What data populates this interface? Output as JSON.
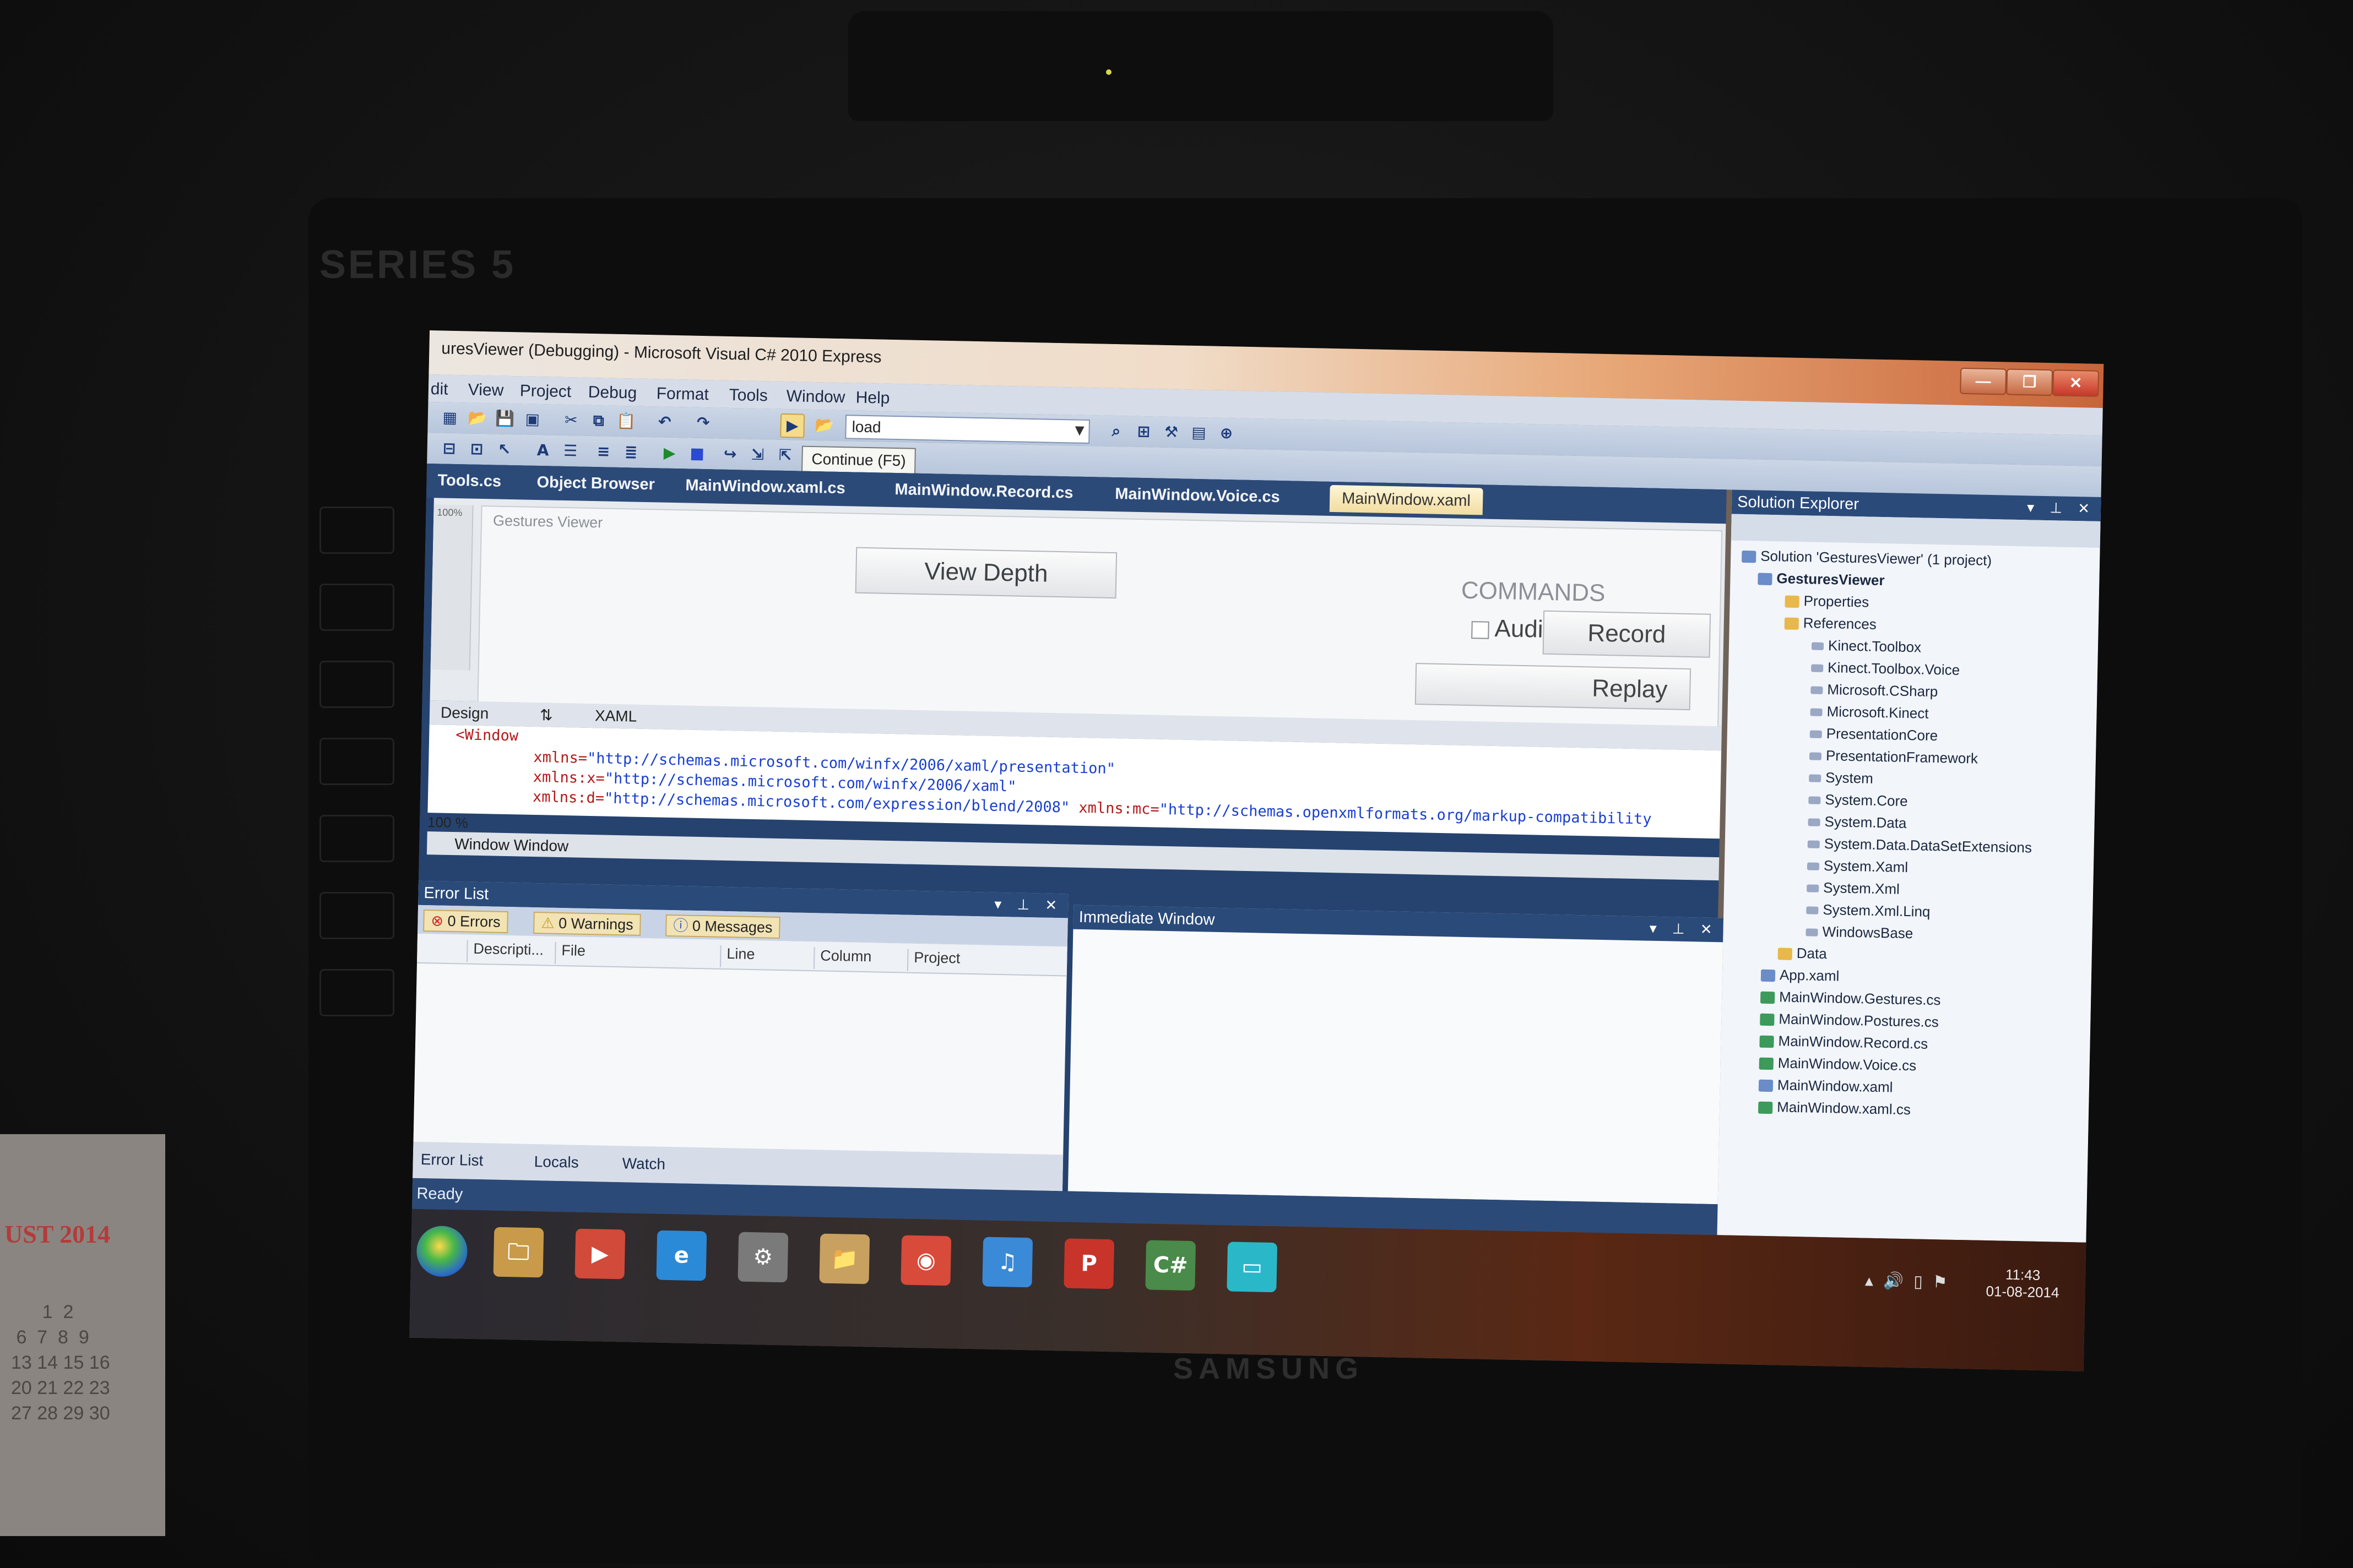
{
  "window": {
    "title": "uresViewer (Debugging) - Microsoft Visual C# 2010 Express",
    "minimize": "—",
    "restore": "❐",
    "close": "✕"
  },
  "menu": [
    "dit",
    "View",
    "Project",
    "Debug",
    "Format",
    "Tools",
    "Window",
    "Help"
  ],
  "toolbar": {
    "config_value": "load",
    "tooltip": "Continue (F5)"
  },
  "doc_tabs": [
    {
      "label": "Tools.cs"
    },
    {
      "label": "Object Browser"
    },
    {
      "label": "MainWindow.xaml.cs"
    },
    {
      "label": "MainWindow.Record.cs"
    },
    {
      "label": "MainWindow.Voice.cs"
    },
    {
      "label": "MainWindow.xaml",
      "active": true
    }
  ],
  "designer": {
    "zoom_label": "100%",
    "frame_title": "Gestures Viewer",
    "view_depth": "View Depth",
    "commands": "COMMANDS",
    "audio": "Audio",
    "record": "Record",
    "replay": "Replay"
  },
  "split_tabs": {
    "design": "Design",
    "swap": "⇅",
    "xaml": "XAML"
  },
  "code": {
    "root": "<Window",
    "lines": [
      {
        "attr": "xmlns=",
        "value": "\"http://schemas.microsoft.com/winfx/2006/xaml/presentation\""
      },
      {
        "attr": "xmlns:x=",
        "value": "\"http://schemas.microsoft.com/winfx/2006/xaml\""
      },
      {
        "attr": "xmlns:d=",
        "value": "\"http://schemas.microsoft.com/expression/blend/2008\"",
        "extra_attr": " xmlns:mc=",
        "extra_value": "\"http://schemas.openxmlformats.org/markup-compatibility"
      }
    ],
    "zoom": "100 %",
    "path": "Window  Window"
  },
  "error_list": {
    "title": "Error List",
    "errors": "0 Errors",
    "warnings": "0 Warnings",
    "messages": "0 Messages",
    "columns": [
      "Descripti...",
      "File",
      "Line",
      "Column",
      "Project"
    ],
    "bottom_tabs": [
      "Error List",
      "Locals",
      "Watch"
    ]
  },
  "immediate": {
    "title": "Immediate Window"
  },
  "status": "Ready",
  "solution_explorer": {
    "title": "Solution Explorer",
    "items": [
      {
        "label": "Solution 'GesturesViewer' (1 project)",
        "kind": "solution"
      },
      {
        "label": "GesturesViewer",
        "kind": "project"
      },
      {
        "label": "Properties",
        "kind": "folder"
      },
      {
        "label": "References",
        "kind": "folder"
      },
      {
        "label": "Kinect.Toolbox",
        "kind": "ref"
      },
      {
        "label": "Kinect.Toolbox.Voice",
        "kind": "ref"
      },
      {
        "label": "Microsoft.CSharp",
        "kind": "ref"
      },
      {
        "label": "Microsoft.Kinect",
        "kind": "ref"
      },
      {
        "label": "PresentationCore",
        "kind": "ref"
      },
      {
        "label": "PresentationFramework",
        "kind": "ref"
      },
      {
        "label": "System",
        "kind": "ref"
      },
      {
        "label": "System.Core",
        "kind": "ref"
      },
      {
        "label": "System.Data",
        "kind": "ref"
      },
      {
        "label": "System.Data.DataSetExtensions",
        "kind": "ref"
      },
      {
        "label": "System.Xaml",
        "kind": "ref"
      },
      {
        "label": "System.Xml",
        "kind": "ref"
      },
      {
        "label": "System.Xml.Linq",
        "kind": "ref"
      },
      {
        "label": "WindowsBase",
        "kind": "ref"
      },
      {
        "label": "Data",
        "kind": "folder"
      },
      {
        "label": "App.xaml",
        "kind": "file"
      },
      {
        "label": "MainWindow.Gestures.cs",
        "kind": "cs"
      },
      {
        "label": "MainWindow.Postures.cs",
        "kind": "cs"
      },
      {
        "label": "MainWindow.Record.cs",
        "kind": "cs"
      },
      {
        "label": "MainWindow.Voice.cs",
        "kind": "cs"
      },
      {
        "label": "MainWindow.xaml",
        "kind": "file"
      },
      {
        "label": "MainWindow.xaml.cs",
        "kind": "cs"
      }
    ]
  },
  "taskbar": {
    "icons": [
      "explorer-icon",
      "media-player-icon",
      "internet-explorer-icon",
      "settings-icon",
      "folder-icon",
      "chrome-icon",
      "itunes-icon",
      "powerpoint-icon",
      "csharp-icon",
      "remote-desktop-icon"
    ],
    "icon_glyphs": [
      "🗀",
      "▶",
      "e",
      "⚙",
      "📁",
      "◉",
      "♫",
      "P",
      "C#",
      "▭"
    ],
    "icon_colors": [
      "#c89a4a",
      "#d24a3a",
      "#2a8ad8",
      "#7a7a7a",
      "#c8a060",
      "#d84a3a",
      "#3a8ad8",
      "#c8342a",
      "#4a8a4a",
      "#2ab8c8"
    ],
    "time": "11:43",
    "date": "01-08-2014"
  },
  "surroundings": {
    "monitor_series": "SERIES 5",
    "monitor_brand": "SAMSUNG",
    "calendar_month": "UST 2014",
    "calendar_days": "      1  2\n 6  7  8  9\n13 14 15 16\n20 21 22 23\n27 28 29 30"
  },
  "colors": {
    "accent": "#2c4a78",
    "titlebar_end": "#c8643a"
  }
}
